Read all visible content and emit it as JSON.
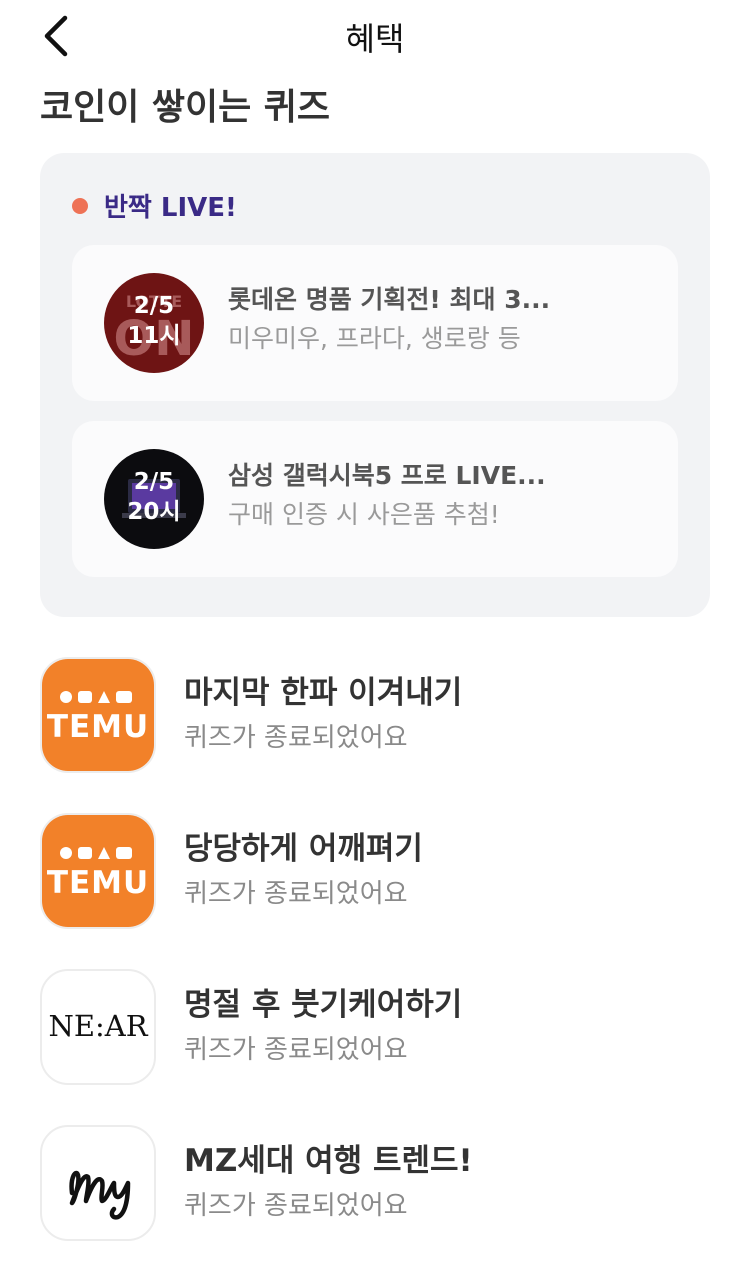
{
  "header": {
    "title": "혜택",
    "back_icon": "chevron-left-icon"
  },
  "section_title": "코인이 쌓이는 퀴즈",
  "live": {
    "label": "반짝 LIVE!",
    "dot_color": "#ee7256",
    "items": [
      {
        "date": "2/5",
        "time": "11시",
        "title": "롯데온 명품 기획전! 최대 3...",
        "subtitle": "미우미우, 프라다, 생로랑 등",
        "logo_text": "LOTTE ON"
      },
      {
        "date": "2/5",
        "time": "20시",
        "title": "삼성 갤럭시북5 프로 LIVE...",
        "subtitle": "구매 인증 시 사은품 추첨!"
      }
    ]
  },
  "quizzes": [
    {
      "logo": "TEMU",
      "title": "마지막 한파 이겨내기",
      "subtitle": "퀴즈가 종료되었어요"
    },
    {
      "logo": "TEMU",
      "title": "당당하게 어깨펴기",
      "subtitle": "퀴즈가 종료되었어요"
    },
    {
      "logo": "NE:AR",
      "title": "명절 후 붓기케어하기",
      "subtitle": "퀴즈가 종료되었어요"
    },
    {
      "logo": "My",
      "title": "MZ세대 여행 트렌드!",
      "subtitle": "퀴즈가 종료되었어요"
    }
  ]
}
